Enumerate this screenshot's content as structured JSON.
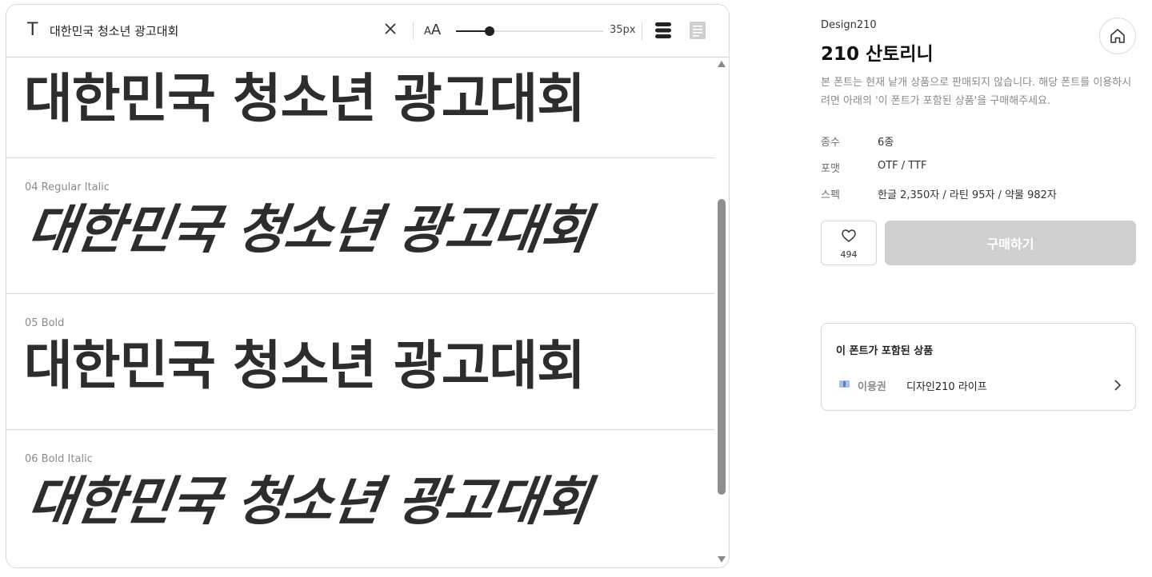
{
  "preview": {
    "sample_text": "대한민국 청소년 광고대회",
    "text_icon": "T",
    "size_icon_small": "A",
    "size_icon_large": "A",
    "size_value": 35,
    "size_label": "35px",
    "size_range": [
      10,
      120
    ],
    "styles": [
      {
        "label": "",
        "text": "대한민국 청소년 광고대회",
        "italic": false
      },
      {
        "label": "04 Regular Italic",
        "text": "대한민국 청소년 광고대회",
        "italic": true
      },
      {
        "label": "05 Bold",
        "text": "대한민국 청소년 광고대회",
        "italic": false
      },
      {
        "label": "06 Bold Italic",
        "text": "대한민국 청소년 광고대회",
        "italic": true
      }
    ],
    "scroll_position": 0.68
  },
  "info": {
    "foundry": "Design210",
    "title": "210 산토리니",
    "notice": "본 폰트는 현재 낱개 상품으로 판매되지 않습니다. 해당 폰트를 이용하시려면 아래의 '이 폰트가 포함된 상품'을 구매해주세요.",
    "specs": [
      {
        "key": "종수",
        "value": "6종"
      },
      {
        "key": "포맷",
        "value": "OTF / TTF"
      },
      {
        "key": "스펙",
        "value": "한글 2,350자 / 라틴 95자 / 약물 982자"
      }
    ],
    "like_count": "494",
    "buy_label": "구매하기",
    "included": {
      "title": "이 폰트가 포함된 상품",
      "product_type": "이용권",
      "product_name": "디자인210 라이프"
    }
  },
  "colors": {
    "specimen": "#2d2d2d",
    "buy_disabled": "#cfcfcf",
    "muted_text": "#8a8a8a"
  }
}
